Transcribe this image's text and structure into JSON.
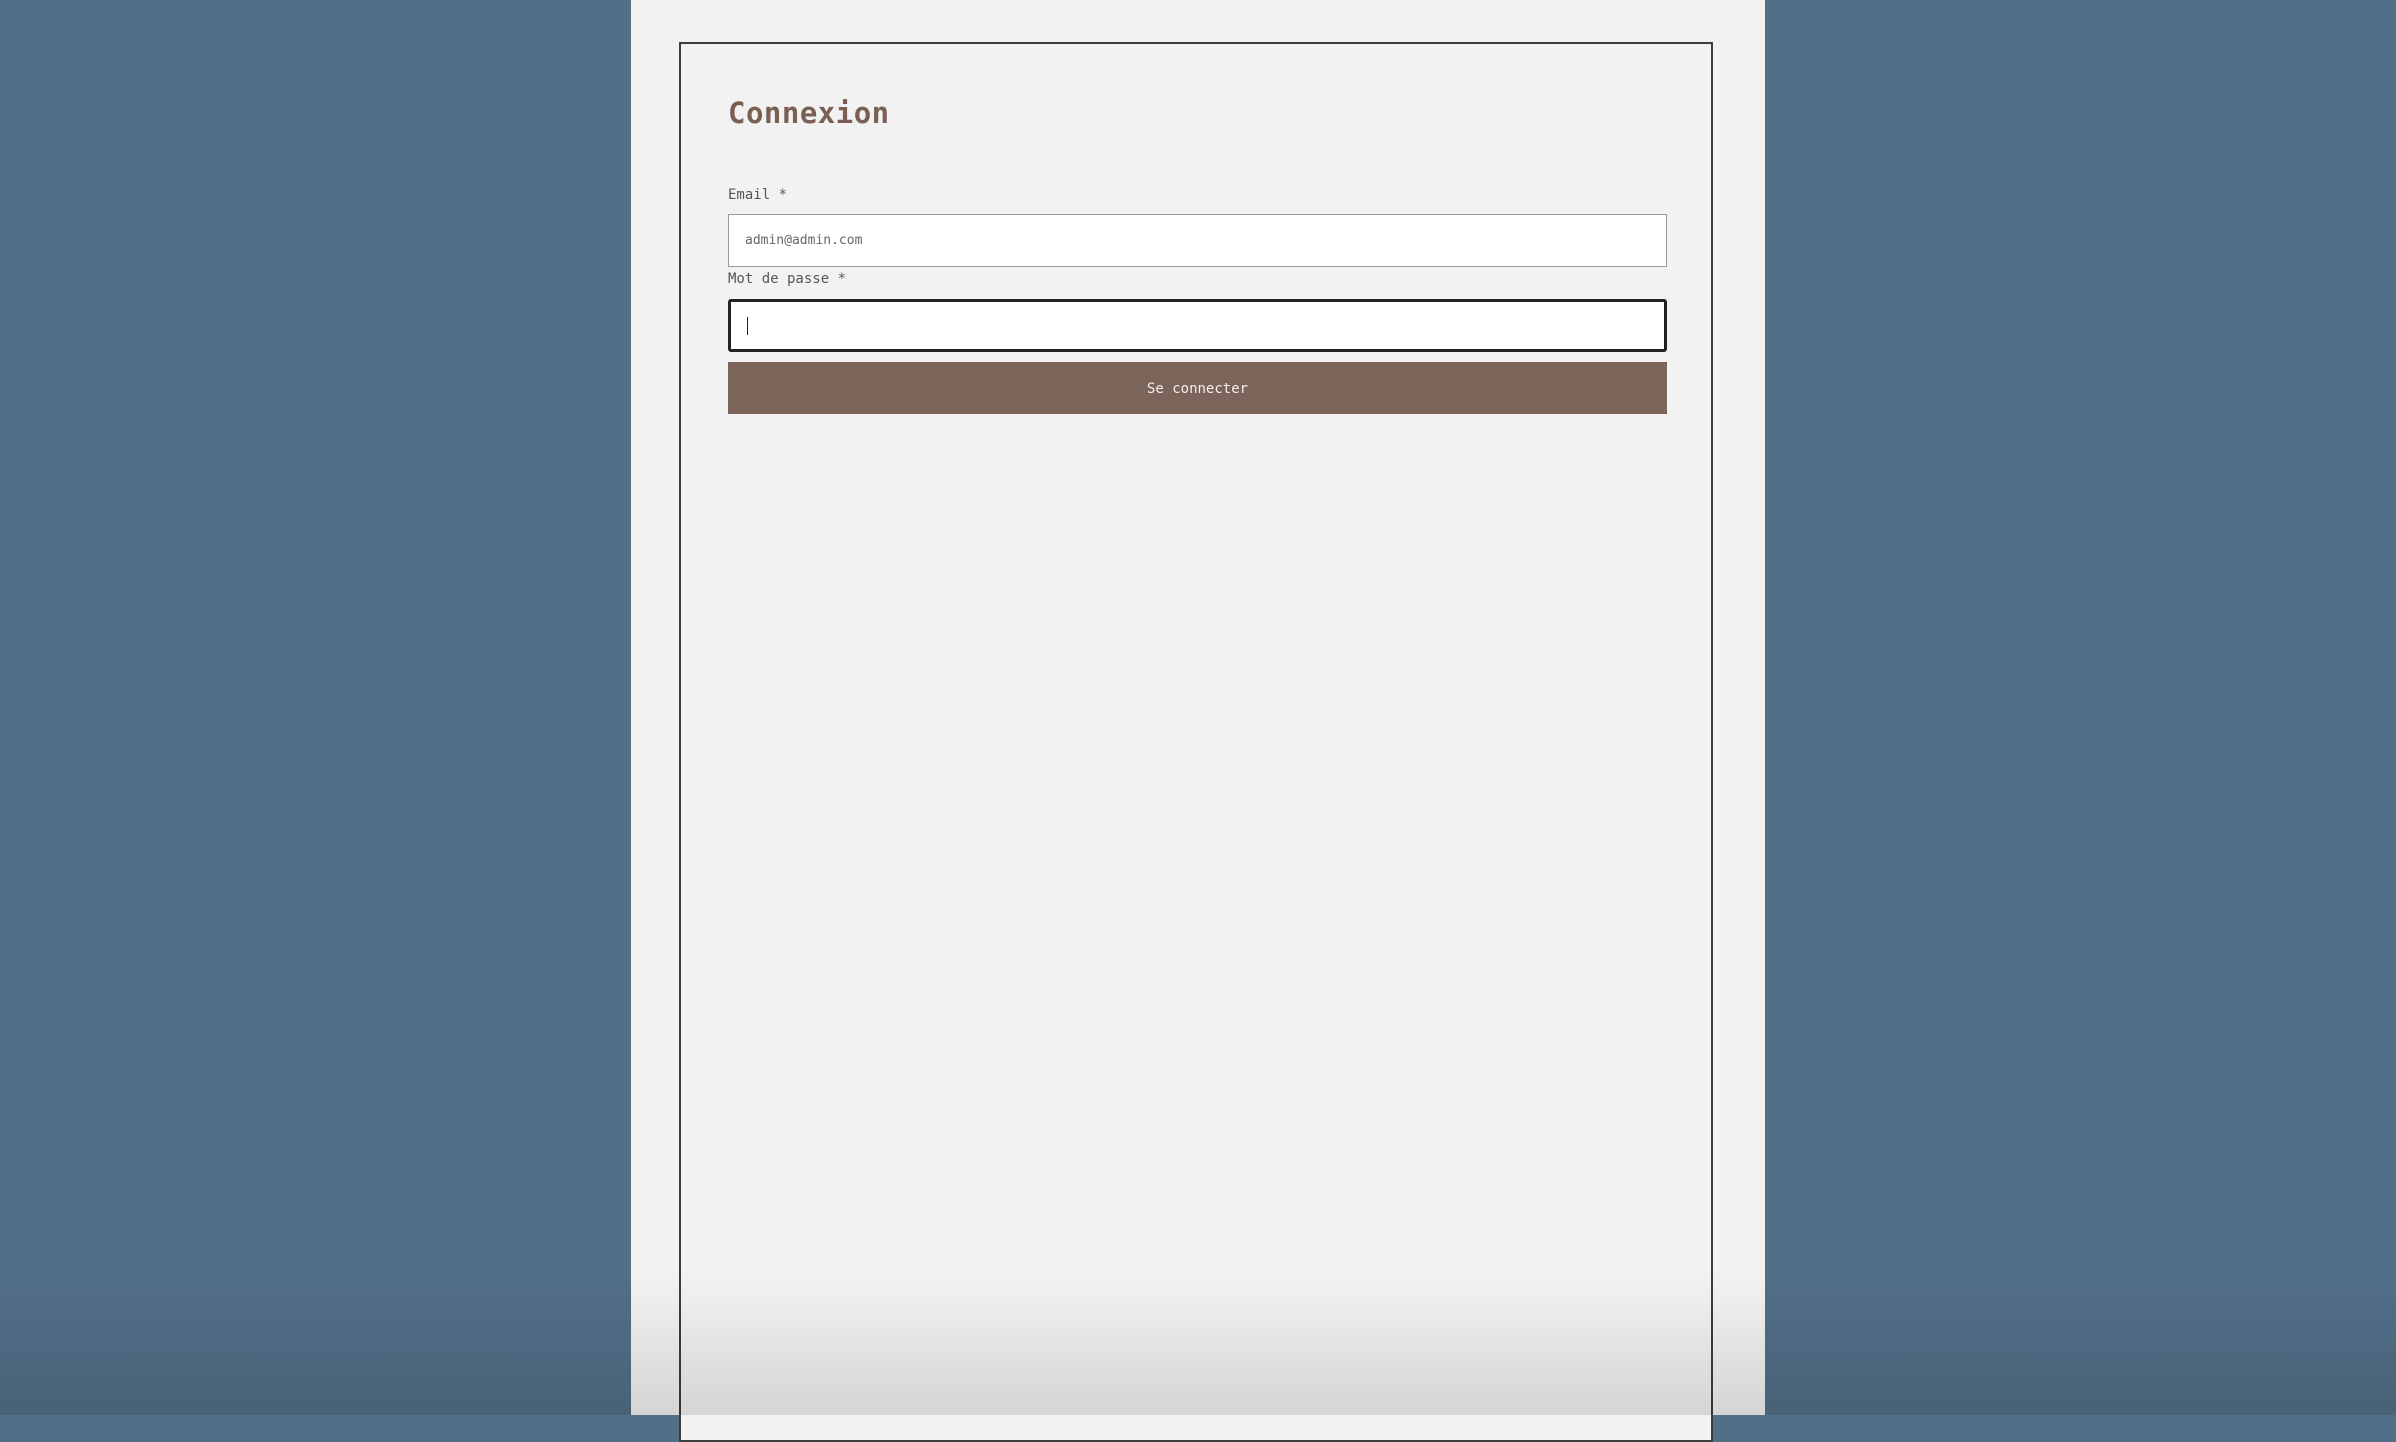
{
  "login": {
    "title": "Connexion",
    "email_label": "Email *",
    "email_value": "admin@admin.com",
    "password_label": "Mot de passe *",
    "password_value": "",
    "submit_label": "Se connecter"
  },
  "colors": {
    "background": "#526f88",
    "panel": "#f3f2f2",
    "accent": "#7b6459",
    "title": "#7a5f53"
  }
}
